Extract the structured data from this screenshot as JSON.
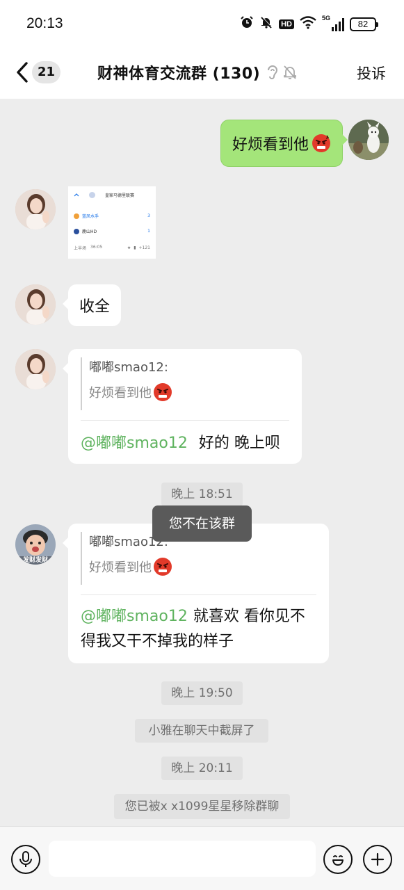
{
  "status_bar": {
    "time": "20:13",
    "hd": "HD",
    "network": "5G",
    "battery": "82"
  },
  "header": {
    "back_count": "21",
    "title": "财神体育交流群 (130)",
    "complain": "投诉"
  },
  "messages": {
    "m1_text": "好烦看到他",
    "thumb": {
      "title": "皇家马德里联赛",
      "team1": "蓝凤水手",
      "score1": "3",
      "team2": "鹿山HD",
      "score2": "1",
      "period": "上半场",
      "clock": "36:05",
      "extra": "+121"
    },
    "m3_text": "收全",
    "m4": {
      "quote_name": "嘟嘟smao12:",
      "quote_text": "好烦看到他",
      "mention": "@嘟嘟smao12",
      "reply": "好的 晚上呗"
    },
    "time1": "晚上 18:51",
    "toast": "您不在该群",
    "m5": {
      "quote_name": "嘟嘟smao12:",
      "quote_text": "好烦看到他",
      "mention": "@嘟嘟smao12",
      "reply_line1": "就喜欢 看你见不",
      "reply_line2": "得我又干不掉我的样子",
      "avatar_caption": "发财发财"
    },
    "time2": "晚上 19:50",
    "sys1": "小雅在聊天中截屏了",
    "time3": "晚上 20:11",
    "sys2": "您已被x x1099星星移除群聊"
  },
  "input": {
    "placeholder": ""
  },
  "colors": {
    "green_bubble": "#a4e57a",
    "mention": "#5fb35f",
    "background": "#ededed"
  }
}
